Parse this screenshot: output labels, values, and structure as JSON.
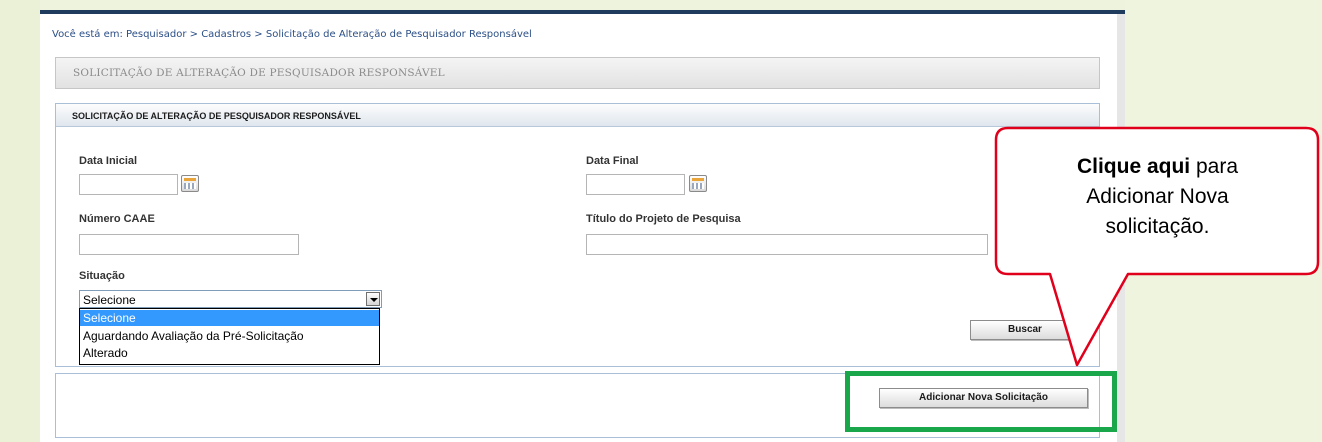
{
  "breadcrumb": "Você está em: Pesquisador > Cadastros > Solicitação de Alteração de Pesquisador Responsável",
  "page_title": "SOLICITAÇÃO DE ALTERAÇÃO DE PESQUISADOR RESPONSÁVEL",
  "form": {
    "header": "SOLICITAÇÃO DE ALTERAÇÃO DE PESQUISADOR RESPONSÁVEL",
    "data_inicial_label": "Data Inicial",
    "data_inicial_value": "",
    "data_final_label": "Data Final",
    "data_final_value": "",
    "numero_caae_label": "Número CAAE",
    "numero_caae_value": "",
    "titulo_label": "Título do Projeto de Pesquisa",
    "titulo_value": "",
    "situacao_label": "Situação",
    "situacao_selected": "Selecione",
    "situacao_options": [
      "Selecione",
      "Aguardando Avaliação da Pré-Solicitação",
      "Alterado"
    ],
    "buscar_label": "Buscar"
  },
  "add_button_label": "Adicionar Nova Solicitação",
  "callout": {
    "bold": "Clique aqui",
    "rest_line1": " para",
    "line2": "Adicionar Nova",
    "line3": "solicitação."
  },
  "colors": {
    "header_border": "#1f3b5e",
    "highlight_green": "#1aa64a",
    "callout_red": "#e0001b",
    "selected_option": "#3399ff"
  },
  "icons": [
    "calendar-icon",
    "chevron-down-icon"
  ]
}
